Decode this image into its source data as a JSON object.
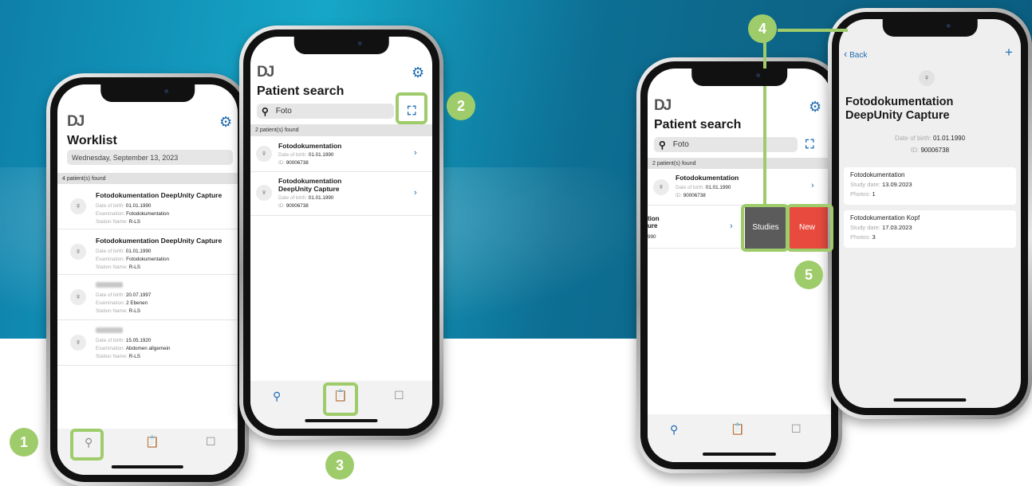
{
  "brand": {
    "logo": "DJ"
  },
  "icons": {
    "gear": "gear-icon",
    "search": "search-icon",
    "clipboard": "clipboard-icon",
    "bookmark": "bookmark-icon",
    "scan": "scan-icon",
    "female": "female-icon",
    "chevron": "chevron-right-icon",
    "plus": "plus-icon",
    "back": "chevron-left-icon"
  },
  "colors": {
    "accent": "#1f6bb2",
    "highlight": "#9fcc6b",
    "studies": "#5b5b5b",
    "new": "#e84b3e"
  },
  "steps": [
    "1",
    "2",
    "3",
    "4",
    "5"
  ],
  "worklist": {
    "title": "Worklist",
    "date": "Wednesday, September 13, 2023",
    "found": "4 patient(s) found",
    "rows": [
      {
        "name": "Fotodokumentation DeepUnity Capture",
        "dob_label": "Date of birth:",
        "dob": "01.01.1990",
        "exam_label": "Examination:",
        "exam": "Fotodokumentation",
        "station_label": "Station Name:",
        "station": "R-LS"
      },
      {
        "name": "Fotodokumentation DeepUnity Capture",
        "dob_label": "Date of birth:",
        "dob": "01.01.1990",
        "exam_label": "Examination:",
        "exam": "Fotodokumentation",
        "station_label": "Station Name:",
        "station": "R-LS"
      },
      {
        "name": "",
        "dob_label": "Date of birth:",
        "dob": "20.07.1997",
        "exam_label": "Examination:",
        "exam": "2 Ebenen",
        "station_label": "Station Name:",
        "station": "R-LS"
      },
      {
        "name": "",
        "dob_label": "Date of birth:",
        "dob": "15.05.1920",
        "exam_label": "Examination:",
        "exam": "Abdomen allgemein",
        "station_label": "Station Name:",
        "station": "R-LS"
      }
    ]
  },
  "search": {
    "title": "Patient search",
    "query": "Foto",
    "found": "2 patient(s) found",
    "rows": [
      {
        "name": "Fotodokumentation",
        "dob_label": "Date of birth:",
        "dob": "01.01.1990",
        "id_label": "ID:",
        "id": "90006738"
      },
      {
        "name": "Fotodokumentation DeepUnity Capture",
        "dob_label": "Date of birth:",
        "dob": "01.01.1990",
        "id_label": "ID:",
        "id": "90006738"
      }
    ],
    "partial": {
      "line1": "tion",
      "line2": "ure",
      "line3": "990"
    },
    "studies_label": "Studies",
    "new_label": "New"
  },
  "detail": {
    "back_label": "Back",
    "name": "Fotodokumentation DeepUnity Capture",
    "dob_label": "Date of birth:",
    "dob": "01.01.1990",
    "id_label": "ID:",
    "id": "90006738",
    "studies": [
      {
        "name": "Fotodokumentation",
        "date_label": "Study date:",
        "date": "13.09.2023",
        "photos_label": "Photos:",
        "photos": "1"
      },
      {
        "name": "Fotodokumentation Kopf",
        "date_label": "Study date:",
        "date": "17.03.2023",
        "photos_label": "Photos:",
        "photos": "3"
      }
    ]
  }
}
